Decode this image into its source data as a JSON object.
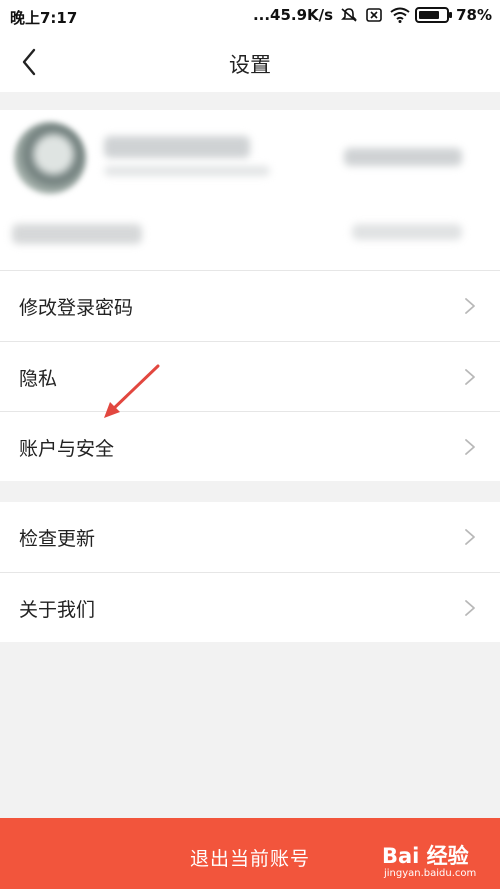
{
  "status_bar": {
    "time": "晚上7:17",
    "network_speed": "...45.9K/s",
    "battery": "78%",
    "battery_level": 0.78,
    "icons": [
      "mute-icon",
      "sim-off-icon",
      "wifi-icon",
      "battery-icon"
    ]
  },
  "nav": {
    "title": "设置",
    "back_icon": "chevron-left-icon"
  },
  "menu_group_1": [
    {
      "label": "修改登录密码"
    },
    {
      "label": "隐私"
    },
    {
      "label": "账户与安全"
    }
  ],
  "menu_group_2": [
    {
      "label": "检查更新"
    },
    {
      "label": "关于我们"
    }
  ],
  "logout": {
    "label": "退出当前账号"
  },
  "watermark": {
    "logo": "Bai 经验",
    "url": "jingyan.baidu.com"
  },
  "colors": {
    "accent": "#f2553c",
    "annotation_arrow": "#e2473f",
    "background": "#f2f2f2"
  }
}
